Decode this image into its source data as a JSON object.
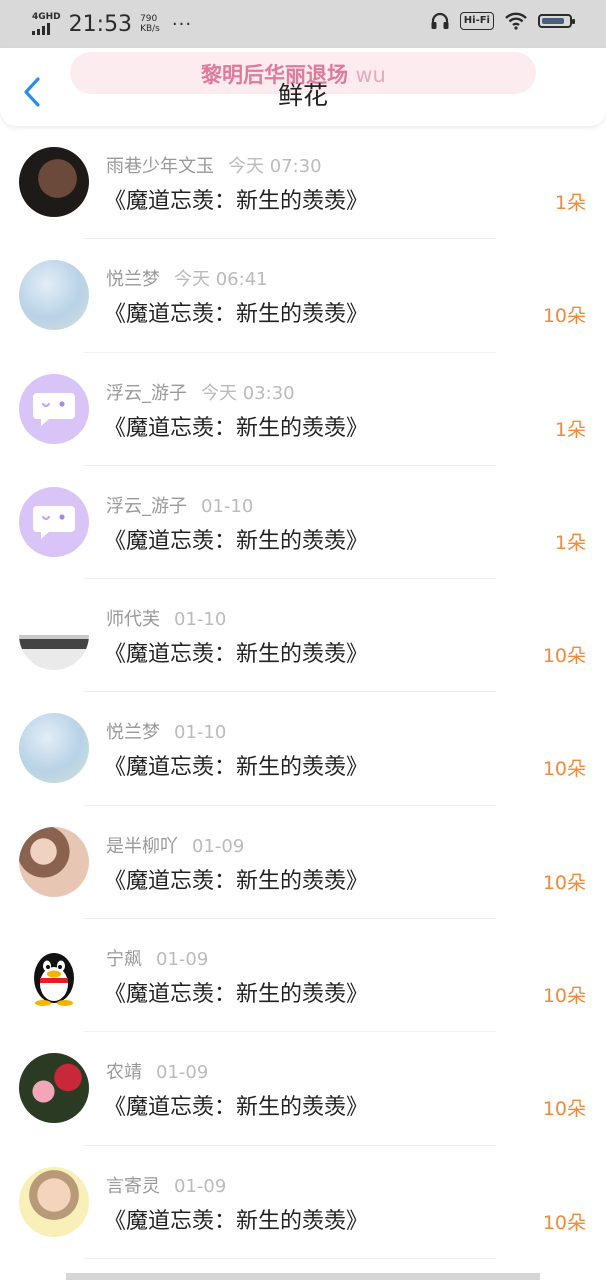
{
  "status_bar": {
    "network": "4GHD",
    "time": "21:53",
    "speed_value": "790",
    "speed_unit": "KB/s",
    "more": "···",
    "hifi": "Hi-Fi",
    "icons": [
      "signal-icon",
      "headphone-icon",
      "wifi-icon",
      "battery-icon"
    ]
  },
  "header": {
    "title": "鲜花",
    "back_icon": "chevron-left-icon",
    "banner_text": "黎明后华丽退场",
    "banner_tail": "wu"
  },
  "colors": {
    "accent_blue": "#2a8cf0",
    "count_orange": "#f08a3c",
    "banner_pink": "#df7a9a",
    "avatar_purple": "#d8c4f6"
  },
  "items": [
    {
      "name": "雨巷少年文玉",
      "time": "今天 07:30",
      "title": "《魔道忘羡：新生的羡羡》",
      "count": "1朵",
      "avatar": "dark"
    },
    {
      "name": "悦兰梦",
      "time": "今天 06:41",
      "title": "《魔道忘羡：新生的羡羡》",
      "count": "10朵",
      "avatar": "light"
    },
    {
      "name": "浮云_游子",
      "time": "今天 03:30",
      "title": "《魔道忘羡：新生的羡羡》",
      "count": "1朵",
      "avatar": "purple"
    },
    {
      "name": "浮云_游子",
      "time": "01-10",
      "title": "《魔道忘羡：新生的羡羡》",
      "count": "1朵",
      "avatar": "purple"
    },
    {
      "name": "师代芙",
      "time": "01-10",
      "title": "《魔道忘羡：新生的羡羡》",
      "count": "10朵",
      "avatar": "bw"
    },
    {
      "name": "悦兰梦",
      "time": "01-10",
      "title": "《魔道忘羡：新生的羡羡》",
      "count": "10朵",
      "avatar": "light"
    },
    {
      "name": "是半柳吖",
      "time": "01-09",
      "title": "《魔道忘羡：新生的羡羡》",
      "count": "10朵",
      "avatar": "kid"
    },
    {
      "name": "宁飙",
      "time": "01-09",
      "title": "《魔道忘羡：新生的羡羡》",
      "count": "10朵",
      "avatar": "qq"
    },
    {
      "name": "农靖",
      "time": "01-09",
      "title": "《魔道忘羡：新生的羡羡》",
      "count": "10朵",
      "avatar": "rose"
    },
    {
      "name": "言寄灵",
      "time": "01-09",
      "title": "《魔道忘羡：新生的羡羡》",
      "count": "10朵",
      "avatar": "boy"
    }
  ]
}
